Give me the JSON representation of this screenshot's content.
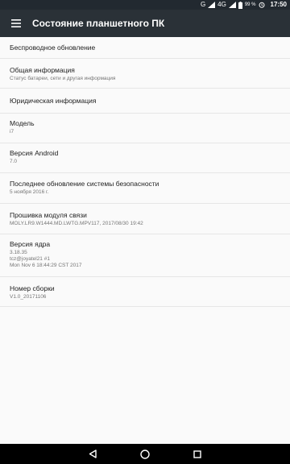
{
  "status_bar": {
    "network": "G",
    "network_4g": "4G",
    "battery_percent": "99 %",
    "time": "17:50"
  },
  "app_bar": {
    "title": "Состояние планшетного ПК",
    "menu_icon": "hamburger-menu-icon"
  },
  "items": [
    {
      "title": "Беспроводное обновление"
    },
    {
      "title": "Общая информация",
      "subtitle": "Статус батареи, сети и другая информация"
    },
    {
      "title": "Юридическая информация"
    },
    {
      "title": "Модель",
      "subtitle": "i7"
    },
    {
      "title": "Версия Android",
      "subtitle": "7.0"
    },
    {
      "title": "Последнее обновление системы безопасности",
      "subtitle": "5 ноября 2016 г."
    },
    {
      "title": "Прошивка модуля связи",
      "subtitle": "MOLY.LR9.W1444.MD.LWTG.MPV117, 2017/08/30 19:42"
    },
    {
      "title": "Версия ядра",
      "subtitle_lines": [
        "3.18.35",
        "tcz@joyatel21 #1",
        "Mon Nov 6 18:44:29 CST 2017"
      ]
    },
    {
      "title": "Номер сборки",
      "subtitle": "V1.0_20171106"
    }
  ],
  "nav_bar": {
    "back_icon": "back-triangle-icon",
    "home_icon": "home-circle-icon",
    "recents_icon": "recents-square-icon"
  }
}
